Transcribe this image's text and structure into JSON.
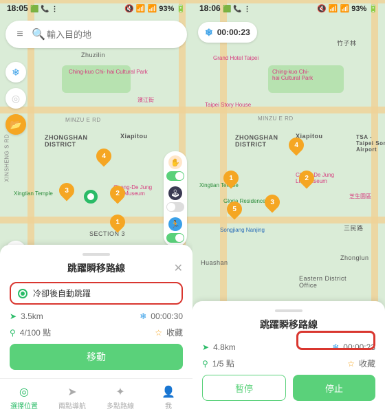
{
  "status_left": {
    "time_a": "18:05",
    "time_b": "18:06",
    "badges": "🟩 📞 ⋮"
  },
  "status_right": "🔇 📶 📶 93% 🔋",
  "search": {
    "placeholder": "輸入目的地"
  },
  "timer_pill": "00:00:23",
  "map": {
    "roads": {
      "minzu": "MINZU E RD",
      "xinsheng": "XINSHENG S RD"
    },
    "areas": {
      "zhongshan": "ZHONGSHAN\nDISTRICT",
      "xiapitou": "Xiapitou",
      "zhulun": "Zhuzilin",
      "huashan": "Huashan",
      "eastern": "Eastern District\nOffice",
      "section3": "SECTION 3",
      "zhonglun": "Zhonglun"
    },
    "pois": {
      "chiangkuo": "Ching-kuo Chi-\nhai Cultural Park",
      "xingtian": "Xingtian Temple",
      "chengdejung": "Cheng-De Jung\nLife Museum",
      "songjiang": "Songjiang Nanjing",
      "grand": "Grand Hotel Taipei",
      "story": "Taipei Story House",
      "gloria": "Gloria Residence",
      "tsa": "TSA -\nTaipei Songs\nAirport",
      "zhisheng": "芝生園區",
      "binjiang": "濱江街"
    }
  },
  "sheet": {
    "title": "跳躍瞬移路線",
    "auto_label": "冷卻後自動跳躍",
    "distance_a": "3.5km",
    "cooldown_a": "00:00:30",
    "points_a": "4/100 點",
    "fav": "收藏",
    "distance_b": "4.8km",
    "cooldown_b": "00:00:23",
    "points_b": "1/5 點",
    "btn_move": "移動",
    "btn_pause": "暫停",
    "btn_stop": "停止"
  },
  "nav": {
    "a": "選擇位置",
    "b": "兩點導航",
    "c": "多點路線",
    "d": "我"
  }
}
